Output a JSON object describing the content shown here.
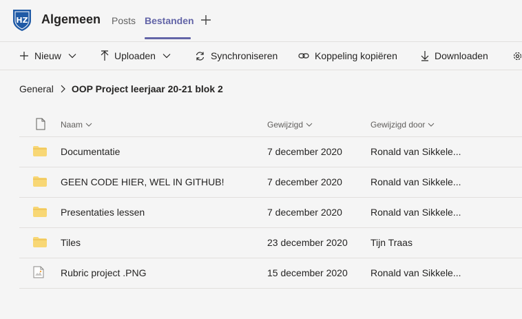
{
  "header": {
    "channel_title": "Algemeen",
    "tabs": [
      {
        "label": "Posts"
      },
      {
        "label": "Bestanden"
      }
    ]
  },
  "toolbar": {
    "new_label": "Nieuw",
    "upload_label": "Uploaden",
    "sync_label": "Synchroniseren",
    "copy_link_label": "Koppeling kopiëren",
    "download_label": "Downloaden"
  },
  "breadcrumb": {
    "root": "General",
    "current": "OOP Project leerjaar 20-21 blok 2"
  },
  "table": {
    "columns": {
      "name": "Naam",
      "modified": "Gewijzigd",
      "modified_by": "Gewijzigd door"
    },
    "rows": [
      {
        "type": "folder",
        "name": "Documentatie",
        "modified": "7 december 2020",
        "modified_by": "Ronald van Sikkele..."
      },
      {
        "type": "folder",
        "name": "GEEN CODE HIER, WEL IN GITHUB!",
        "modified": "7 december 2020",
        "modified_by": "Ronald van Sikkele..."
      },
      {
        "type": "folder",
        "name": "Presentaties lessen",
        "modified": "7 december 2020",
        "modified_by": "Ronald van Sikkele..."
      },
      {
        "type": "folder",
        "name": "Tiles",
        "modified": "23 december 2020",
        "modified_by": "Tijn Traas"
      },
      {
        "type": "image",
        "name": "Rubric project .PNG",
        "modified": "15 december 2020",
        "modified_by": "Ronald van Sikkele..."
      }
    ]
  },
  "colors": {
    "accent": "#6264a7",
    "folder": "#f8d775",
    "logo_blue": "#1f5aa6"
  }
}
